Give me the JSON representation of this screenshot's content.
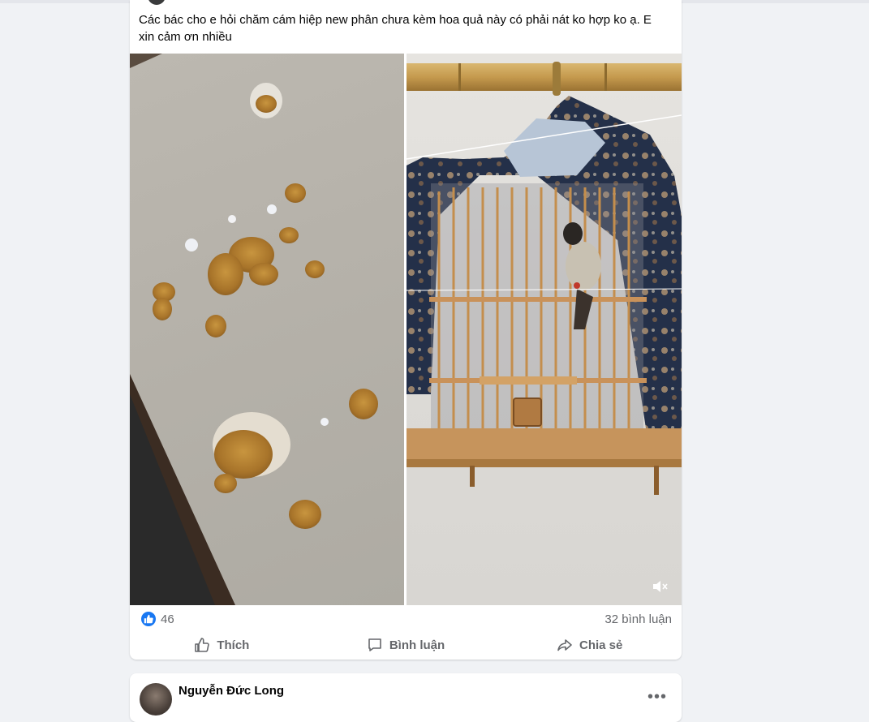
{
  "post": {
    "text": "Các bác cho e hỏi chăm cám hiệp new phân chưa kèm hoa quả này có phải nát ko hợp ko ạ. E xin cảm ơn nhiều",
    "reactions": {
      "icon": "like-icon",
      "count": "46"
    },
    "comments_count": "32 bình luận",
    "actions": [
      {
        "label": "Thích",
        "icon": "thumb-up-icon"
      },
      {
        "label": "Bình luận",
        "icon": "comment-icon"
      },
      {
        "label": "Chia sẻ",
        "icon": "share-icon"
      }
    ],
    "media": [
      {
        "icon": "photo"
      },
      {
        "icon": "video",
        "control": "volume-muted-icon"
      }
    ]
  },
  "next_post": {
    "author": "Nguyễn Đức Long",
    "menu_icon": "more-horizontal-icon"
  },
  "colors": {
    "accent": "#1877f2",
    "background": "#f0f2f5",
    "muted_text": "#65676b"
  }
}
